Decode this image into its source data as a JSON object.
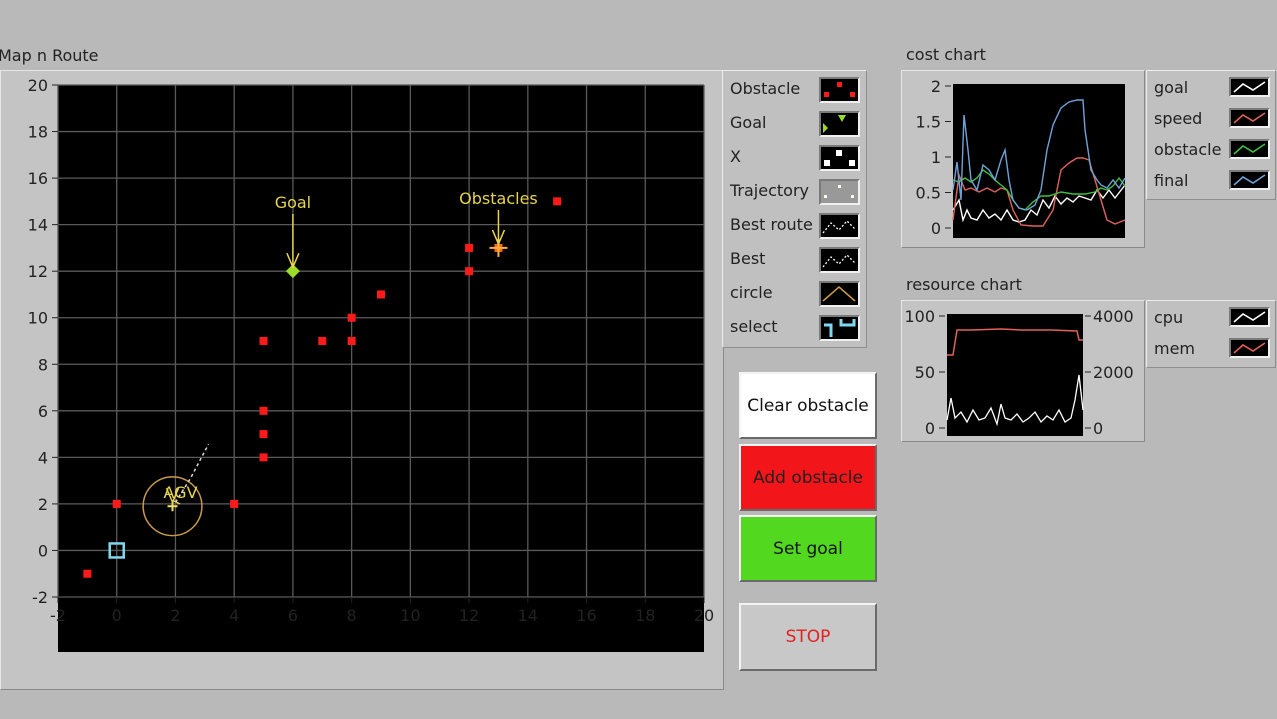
{
  "map": {
    "title": "Map n Route",
    "x_ticks": [
      "-2",
      "0",
      "2",
      "4",
      "6",
      "8",
      "10",
      "12",
      "14",
      "16",
      "18",
      "20"
    ],
    "y_ticks": [
      "-2",
      "0",
      "2",
      "4",
      "6",
      "8",
      "10",
      "12",
      "14",
      "16",
      "18",
      "20"
    ],
    "goal_label": "Goal",
    "obstacles_label": "Obstacles",
    "agv_label": "AGV"
  },
  "map_legend": [
    {
      "label": "Obstacle",
      "icon": "obstacle-swatch-icon"
    },
    {
      "label": "Goal",
      "icon": "goal-swatch-icon"
    },
    {
      "label": "X",
      "icon": "x-swatch-icon"
    },
    {
      "label": "Trajectory",
      "icon": "trajectory-swatch-icon"
    },
    {
      "label": "Best route",
      "icon": "best-route-swatch-icon"
    },
    {
      "label": "Best",
      "icon": "best-swatch-icon"
    },
    {
      "label": "circle",
      "icon": "circle-swatch-icon"
    },
    {
      "label": "select",
      "icon": "select-swatch-icon"
    }
  ],
  "buttons": {
    "clear": "Clear obstacle",
    "add": "Add obstacle",
    "goal": "Set goal",
    "stop": "STOP"
  },
  "colors": {
    "add_button": "#f2151a",
    "goal_button": "#52d81e",
    "stop_text": "#e42020",
    "obstacle": "#ff1a1a",
    "goal_marker": "#9bdc2a",
    "annotation": "#e6d44a",
    "circle": "#c89a4e",
    "select": "#7fd8f0"
  },
  "cost_chart": {
    "title": "cost chart",
    "y_ticks": [
      "2",
      "1.5",
      "1",
      "0.5",
      "0"
    ],
    "legend": [
      {
        "label": "goal",
        "color": "#ffffff"
      },
      {
        "label": "speed",
        "color": "#e0625a"
      },
      {
        "label": "obstacle",
        "color": "#3fbf3f"
      },
      {
        "label": "final",
        "color": "#6fa3d8"
      }
    ]
  },
  "resource_chart": {
    "title": "resource chart",
    "left_ticks": [
      "100",
      "50",
      "0"
    ],
    "right_ticks": [
      "4000",
      "2000",
      "0"
    ],
    "legend": [
      {
        "label": "cpu",
        "color": "#ffffff"
      },
      {
        "label": "mem",
        "color": "#e0625a"
      }
    ]
  },
  "chart_data": {
    "type": "scatter",
    "title": "Map n Route",
    "xlim": [
      -2,
      20
    ],
    "ylim": [
      -2,
      20
    ],
    "grid": true,
    "obstacles": [
      {
        "x": -1,
        "y": -1
      },
      {
        "x": 0,
        "y": 2
      },
      {
        "x": 4,
        "y": 2
      },
      {
        "x": 5,
        "y": 4
      },
      {
        "x": 5,
        "y": 5
      },
      {
        "x": 5,
        "y": 6
      },
      {
        "x": 5,
        "y": 9
      },
      {
        "x": 7,
        "y": 9
      },
      {
        "x": 8,
        "y": 9
      },
      {
        "x": 8,
        "y": 10
      },
      {
        "x": 9,
        "y": 11
      },
      {
        "x": 12,
        "y": 12
      },
      {
        "x": 12,
        "y": 13
      },
      {
        "x": 15,
        "y": 15
      }
    ],
    "goal": {
      "x": 6,
      "y": 12
    },
    "target_obstacle": {
      "x": 13,
      "y": 13
    },
    "agv": {
      "x": 1.9,
      "y": 1.9
    },
    "select": {
      "x": 0,
      "y": 0
    },
    "circle_radius": 1
  }
}
